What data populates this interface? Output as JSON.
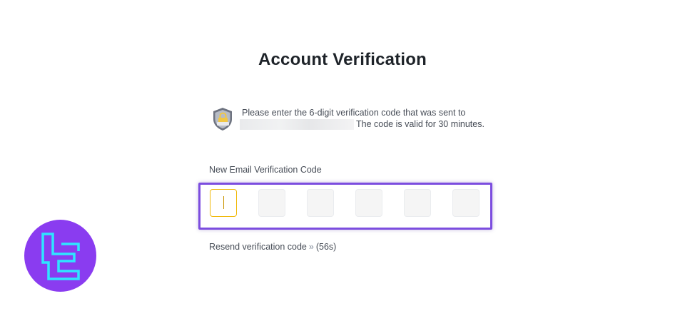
{
  "page": {
    "title": "Account Verification"
  },
  "notice": {
    "icon": "shield-lock-icon",
    "line1": "Please enter the 6-digit verification code that was sent to",
    "line2": "The code is valid for 30 minutes."
  },
  "code_field": {
    "label": "New Email Verification Code",
    "digits": [
      "",
      "",
      "",
      "",
      "",
      ""
    ],
    "active_index": 0
  },
  "resend": {
    "label": "Resend verification code",
    "chevron": "»",
    "countdown": "(56s)"
  },
  "brand_logo": {
    "icon": "tc-logo-icon"
  },
  "colors": {
    "highlight": "#7c4ddf",
    "active_box_border": "#f0b90b",
    "logo_background": "#8a3cf0",
    "logo_stroke": "#2ee6ff"
  }
}
